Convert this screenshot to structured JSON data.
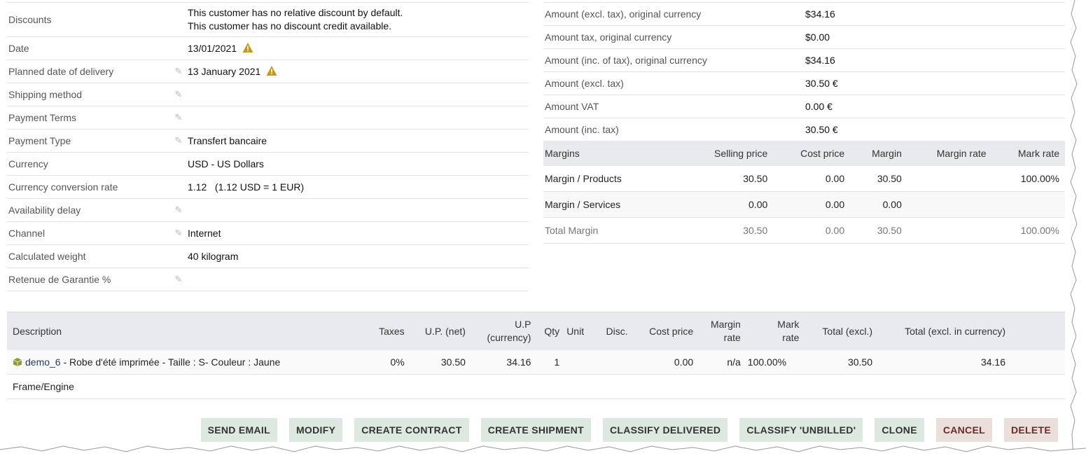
{
  "left": {
    "discounts_label": "Discounts",
    "discounts_line1": "This customer has no relative discount by default.",
    "discounts_line2": "This customer has no discount credit available.",
    "date_label": "Date",
    "date_value": "13/01/2021",
    "planned_label": "Planned date of delivery",
    "planned_value": "13 January 2021",
    "shipping_label": "Shipping method",
    "payterms_label": "Payment Terms",
    "paytype_label": "Payment Type",
    "paytype_value": "Transfert bancaire",
    "currency_label": "Currency",
    "currency_value": "USD - US Dollars",
    "rate_label": "Currency conversion rate",
    "rate_value": "1.12   (1.12 USD = 1 EUR)",
    "avail_label": "Availability delay",
    "channel_label": "Channel",
    "channel_value": "Internet",
    "weight_label": "Calculated weight",
    "weight_value": "40 kilogram",
    "retenue_label": "Retenue de Garantie %"
  },
  "amounts": [
    {
      "label": "Amount (excl. tax), original currency",
      "value": "$34.16"
    },
    {
      "label": "Amount tax, original currency",
      "value": "$0.00"
    },
    {
      "label": "Amount (inc. of tax), original currency",
      "value": "$34.16"
    },
    {
      "label": "Amount (excl. tax)",
      "value": "30.50 €"
    },
    {
      "label": "Amount VAT",
      "value": "0.00 €"
    },
    {
      "label": "Amount (inc. tax)",
      "value": "30.50 €"
    }
  ],
  "margins": {
    "headers": [
      "Margins",
      "Selling price",
      "Cost price",
      "Margin",
      "Margin rate",
      "Mark rate"
    ],
    "rows": [
      [
        "Margin / Products",
        "30.50",
        "0.00",
        "30.50",
        "",
        "100.00%"
      ],
      [
        "Margin / Services",
        "0.00",
        "0.00",
        "0.00",
        "",
        ""
      ],
      [
        "Total Margin",
        "30.50",
        "0.00",
        "30.50",
        "",
        "100.00%"
      ]
    ]
  },
  "lines": {
    "h_desc": "Description",
    "h_taxes": "Taxes",
    "h_upnet": "U.P. (net)",
    "h_upcur1": "U.P",
    "h_upcur2": "(currency)",
    "h_qty": "Qty",
    "h_unit": "Unit",
    "h_disc": "Disc.",
    "h_cost": "Cost price",
    "h_mrate1": "Margin",
    "h_mrate2": "rate",
    "h_mark1": "Mark",
    "h_mark2": "rate",
    "h_total": "Total (excl.)",
    "h_totalcur": "Total (excl. in currency)",
    "product_ref": "demo_6",
    "product_desc": " - Robe d'été imprimée - Taille : S- Couleur : Jaune",
    "taxes": "0%",
    "upnet": "30.50",
    "upcur": "34.16",
    "qty": "1",
    "unit": "",
    "disc": "",
    "cost": "0.00",
    "mrate": "n/a",
    "mark": "100.00%",
    "total": "30.50",
    "totalcur": "34.16",
    "note": "Frame/Engine"
  },
  "actions": {
    "send_email": "SEND EMAIL",
    "modify": "MODIFY",
    "create_contract": "CREATE CONTRACT",
    "create_shipment": "CREATE SHIPMENT",
    "classify_delivered": "CLASSIFY DELIVERED",
    "classify_unbilled": "CLASSIFY 'UNBILLED'",
    "clone": "CLONE",
    "cancel": "CANCEL",
    "delete": "DELETE"
  },
  "colors": {
    "warning": "#c49a1a",
    "button_bg": "#dce8e0",
    "danger_bg": "#eadfdb",
    "header_bg": "#e8eaed"
  }
}
